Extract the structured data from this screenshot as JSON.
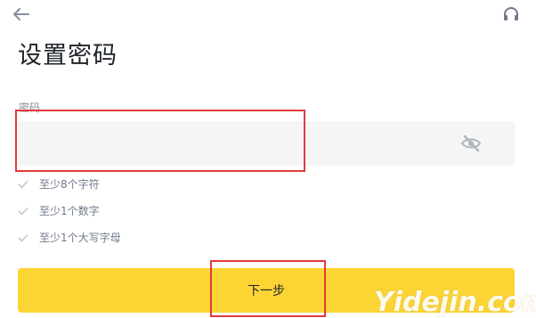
{
  "header": {
    "back_icon": "arrow-left-icon",
    "support_icon": "headset-icon",
    "title": "设置密码"
  },
  "password_field": {
    "label": "密码",
    "value": "",
    "placeholder": "",
    "visibility_icon": "eye-off-icon"
  },
  "requirements": [
    {
      "text": "至少8个字符",
      "icon": "check-icon"
    },
    {
      "text": "至少1个数字",
      "icon": "check-icon"
    },
    {
      "text": "至少1个大写字母",
      "icon": "check-icon"
    }
  ],
  "next_button": {
    "label": "下一步"
  },
  "colors": {
    "accent": "#fcd535",
    "highlight": "#e03b3b",
    "field_bg": "#f5f5f5"
  },
  "watermark": "Yidejin.com"
}
